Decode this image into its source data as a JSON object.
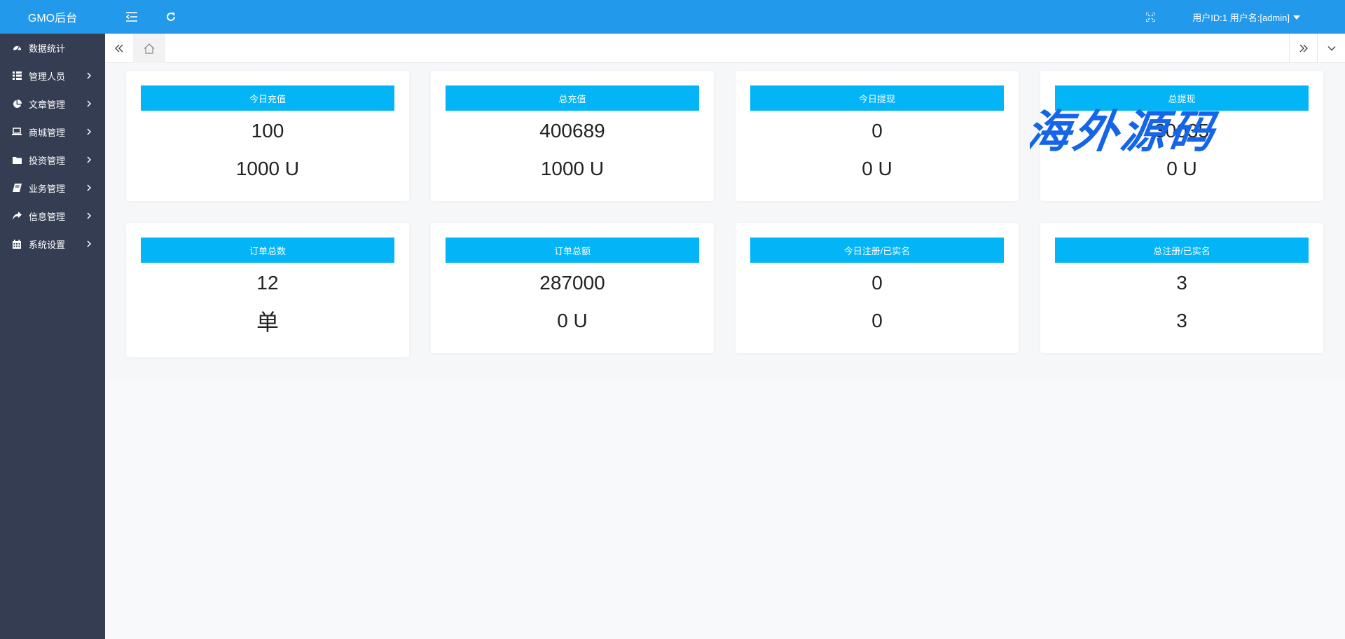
{
  "app": {
    "title": "GMO后台"
  },
  "sidebar": {
    "items": [
      {
        "label": "数据统计",
        "icon": "dashboard-icon",
        "expandable": false
      },
      {
        "label": "管理人员",
        "icon": "grid-icon",
        "expandable": true
      },
      {
        "label": "文章管理",
        "icon": "pie-chart-icon",
        "expandable": true
      },
      {
        "label": "商城管理",
        "icon": "laptop-icon",
        "expandable": true
      },
      {
        "label": "投资管理",
        "icon": "folder-icon",
        "expandable": true
      },
      {
        "label": "业务管理",
        "icon": "book-icon",
        "expandable": true
      },
      {
        "label": "信息管理",
        "icon": "share-icon",
        "expandable": true
      },
      {
        "label": "系统设置",
        "icon": "calendar-icon",
        "expandable": true
      }
    ]
  },
  "header": {
    "user_label": "用户ID:1 用户名:[admin]",
    "icons": [
      "menu-toggle-icon",
      "refresh-icon",
      "fullscreen-icon",
      "chevron-down-icon"
    ]
  },
  "tabs": {
    "icons": [
      "double-chevron-left-icon",
      "home-icon",
      "double-chevron-right-icon",
      "chevron-down-icon"
    ]
  },
  "cards": [
    {
      "title": "今日充值",
      "value": "100",
      "sub": "1000 U"
    },
    {
      "title": "总充值",
      "value": "400689",
      "sub": "1000 U"
    },
    {
      "title": "今日提现",
      "value": "0",
      "sub": "0 U"
    },
    {
      "title": "总提现",
      "value": "30035",
      "sub": "0 U"
    },
    {
      "title": "订单总数",
      "value": "12",
      "sub": "单"
    },
    {
      "title": "订单总额",
      "value": "287000",
      "sub": "0 U"
    },
    {
      "title": "今日注册/已实名",
      "value": "0",
      "sub": "0"
    },
    {
      "title": "总注册/已实名",
      "value": "3",
      "sub": "3"
    }
  ],
  "watermark": {
    "text": "海外源码"
  },
  "colors": {
    "sidebar": "#353d52",
    "header": "#2399ec",
    "card_head": "#03b4f6",
    "watermark": "#1565e8"
  }
}
